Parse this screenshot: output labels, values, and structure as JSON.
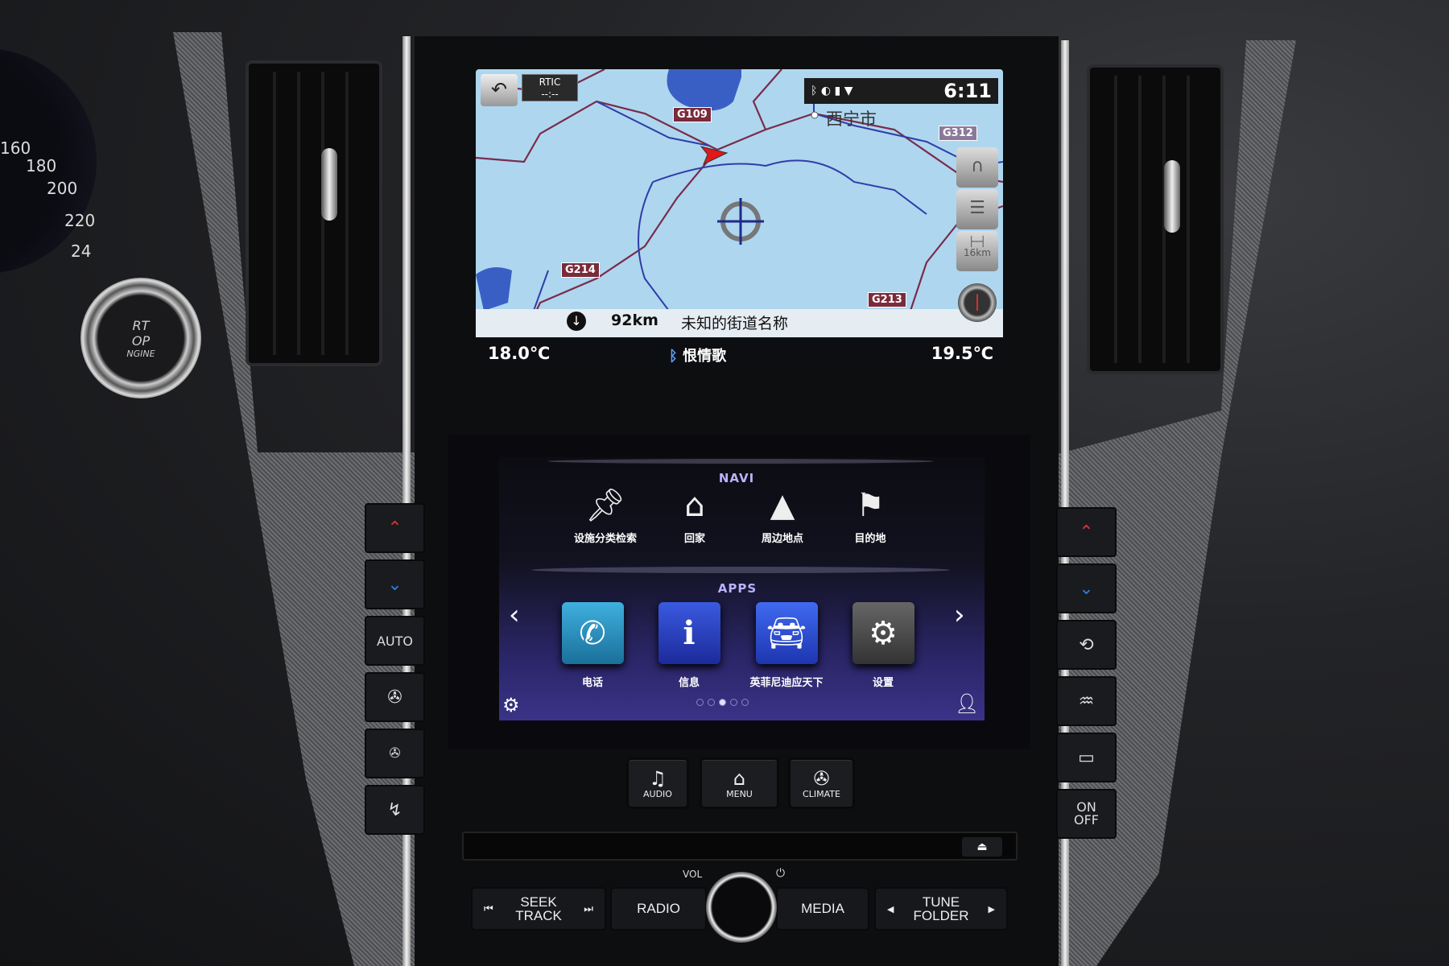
{
  "nav_screen": {
    "rtic": {
      "label": "RTIC",
      "value": "--:--"
    },
    "clock": "6:11",
    "status_icons": [
      "bluetooth-icon",
      "phone-icon",
      "battery-icon",
      "signal-icon"
    ],
    "city": "西宁市",
    "roads": [
      "G109",
      "G312",
      "G214",
      "G213"
    ],
    "scale": "16km",
    "distance": "92km",
    "street": "未知的街道名称",
    "temp_left": "18.0℃",
    "temp_right": "19.5℃",
    "now_playing": "恨情歌"
  },
  "menu_screen": {
    "navi_title": "NAVI",
    "navi_items": [
      {
        "label": "设施分类检索",
        "icon": "pin-icon"
      },
      {
        "label": "回家",
        "icon": "home-icon"
      },
      {
        "label": "周边地点",
        "icon": "nearby-search-icon"
      },
      {
        "label": "目的地",
        "icon": "checkered-flag-icon"
      }
    ],
    "apps_title": "APPS",
    "apps": [
      {
        "label": "电话",
        "icon": "phone-icon",
        "color": "#1f8fc0"
      },
      {
        "label": "信息",
        "icon": "info-icon",
        "color": "#2742c6"
      },
      {
        "label": "英菲尼迪应天下",
        "icon": "connected-car-icon",
        "color": "#2a4fd6"
      },
      {
        "label": "设置",
        "icon": "gear-icon",
        "color": "#4a4a55"
      }
    ],
    "page_count": 5,
    "current_page": 3
  },
  "hard_keys": {
    "audio": "AUDIO",
    "menu": "MENU",
    "climate": "CLIMATE"
  },
  "bottom": {
    "vol": "VOL",
    "seek": "SEEK",
    "track": "TRACK",
    "radio": "RADIO",
    "media": "MEDIA",
    "tune": "TUNE",
    "folder": "FOLDER"
  },
  "climate_left": {
    "auto": "AUTO"
  },
  "climate_right": {
    "on": "ON",
    "off": "OFF"
  },
  "gauge": [
    "160",
    "180",
    "200",
    "220",
    "24"
  ],
  "start_button": {
    "line1": "RT",
    "line2": "OP",
    "line3": "NGINE"
  }
}
